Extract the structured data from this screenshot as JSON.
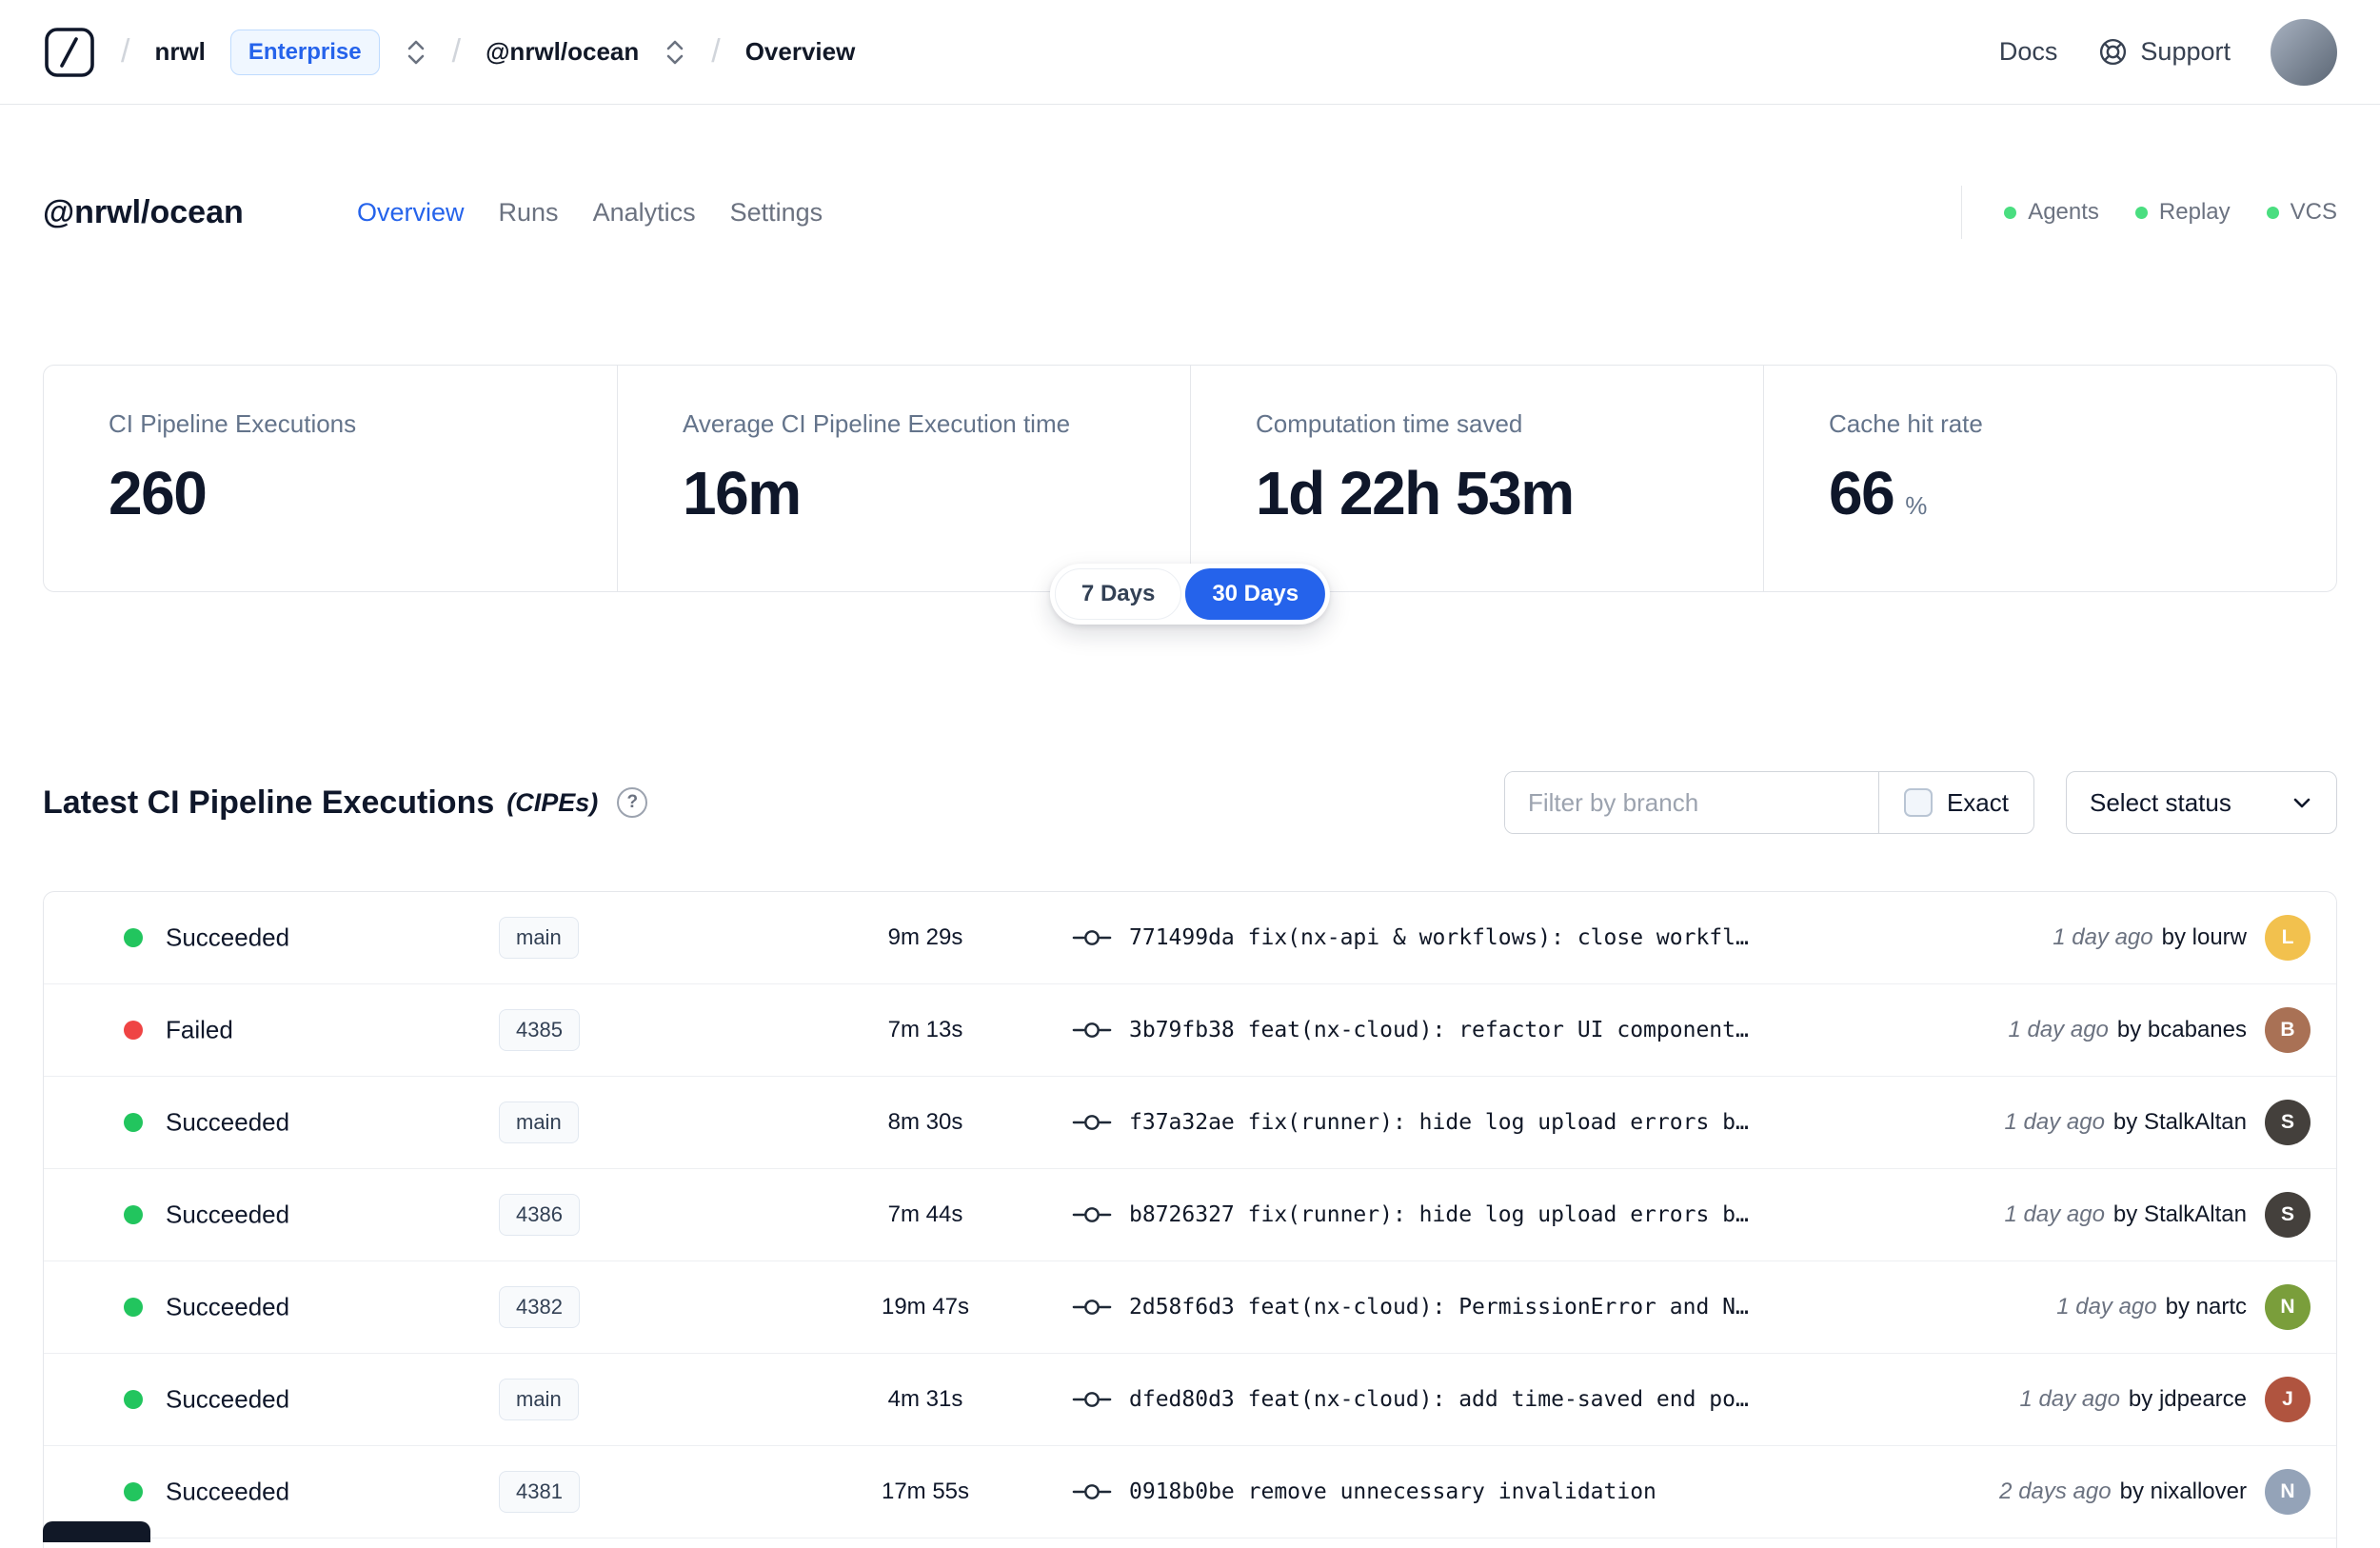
{
  "navbar": {
    "separator": "/",
    "org": "nrwl",
    "org_badge": "Enterprise",
    "workspace": "@nrwl/ocean",
    "page": "Overview",
    "docs": "Docs",
    "support": "Support"
  },
  "header": {
    "title": "@nrwl/ocean",
    "tabs": [
      "Overview",
      "Runs",
      "Analytics",
      "Settings"
    ],
    "active_tab": "Overview",
    "indicators": [
      "Agents",
      "Replay",
      "VCS"
    ]
  },
  "stats": {
    "cards": [
      {
        "label": "CI Pipeline Executions",
        "value": "260",
        "suffix": ""
      },
      {
        "label": "Average CI Pipeline Execution time",
        "value": "16m",
        "suffix": ""
      },
      {
        "label": "Computation time saved",
        "value": "1d 22h 53m",
        "suffix": ""
      },
      {
        "label": "Cache hit rate",
        "value": "66",
        "suffix": "%"
      }
    ],
    "range": {
      "option_7": "7 Days",
      "option_30": "30 Days",
      "selected": "30 Days"
    }
  },
  "cipes": {
    "title": "Latest CI Pipeline Executions",
    "suffix": "(CIPEs)",
    "help_glyph": "?",
    "filter_placeholder": "Filter by branch",
    "exact": "Exact",
    "select_status": "Select status",
    "rows": [
      {
        "status": "Succeeded",
        "dot": "#22c55e",
        "branch": "main",
        "duration": "9m 29s",
        "hash": "771499da",
        "message": "fix(nx-api & workflows): close workfl…",
        "time": "1 day ago",
        "author": "by lourw",
        "avatar_color": "#f2c14e",
        "avatar_initial": "L"
      },
      {
        "status": "Failed",
        "dot": "#ef4444",
        "branch": "4385",
        "duration": "7m 13s",
        "hash": "3b79fb38",
        "message": "feat(nx-cloud): refactor UI component…",
        "time": "1 day ago",
        "author": "by bcabanes",
        "avatar_color": "#a97155",
        "avatar_initial": "B"
      },
      {
        "status": "Succeeded",
        "dot": "#22c55e",
        "branch": "main",
        "duration": "8m 30s",
        "hash": "f37a32ae",
        "message": "fix(runner): hide log upload errors b…",
        "time": "1 day ago",
        "author": "by StalkAltan",
        "avatar_color": "#44403c",
        "avatar_initial": "S"
      },
      {
        "status": "Succeeded",
        "dot": "#22c55e",
        "branch": "4386",
        "duration": "7m 44s",
        "hash": "b8726327",
        "message": "fix(runner): hide log upload errors b…",
        "time": "1 day ago",
        "author": "by StalkAltan",
        "avatar_color": "#44403c",
        "avatar_initial": "S"
      },
      {
        "status": "Succeeded",
        "dot": "#22c55e",
        "branch": "4382",
        "duration": "19m 47s",
        "hash": "2d58f6d3",
        "message": "feat(nx-cloud): PermissionError and N…",
        "time": "1 day ago",
        "author": "by nartc",
        "avatar_color": "#7a9e3b",
        "avatar_initial": "N"
      },
      {
        "status": "Succeeded",
        "dot": "#22c55e",
        "branch": "main",
        "duration": "4m 31s",
        "hash": "dfed80d3",
        "message": "feat(nx-cloud): add time-saved end po…",
        "time": "1 day ago",
        "author": "by jdpearce",
        "avatar_color": "#b0543f",
        "avatar_initial": "J"
      },
      {
        "status": "Succeeded",
        "dot": "#22c55e",
        "branch": "4381",
        "duration": "17m 55s",
        "hash": "0918b0be",
        "message": "remove unnecessary invalidation",
        "time": "2 days ago",
        "author": "by nixallover",
        "avatar_color": "#94a3b8",
        "avatar_initial": "N"
      }
    ]
  },
  "colors": {
    "accent": "#2563eb",
    "success": "#22c55e",
    "failure": "#ef4444",
    "indicator_green": "#4ade80"
  }
}
